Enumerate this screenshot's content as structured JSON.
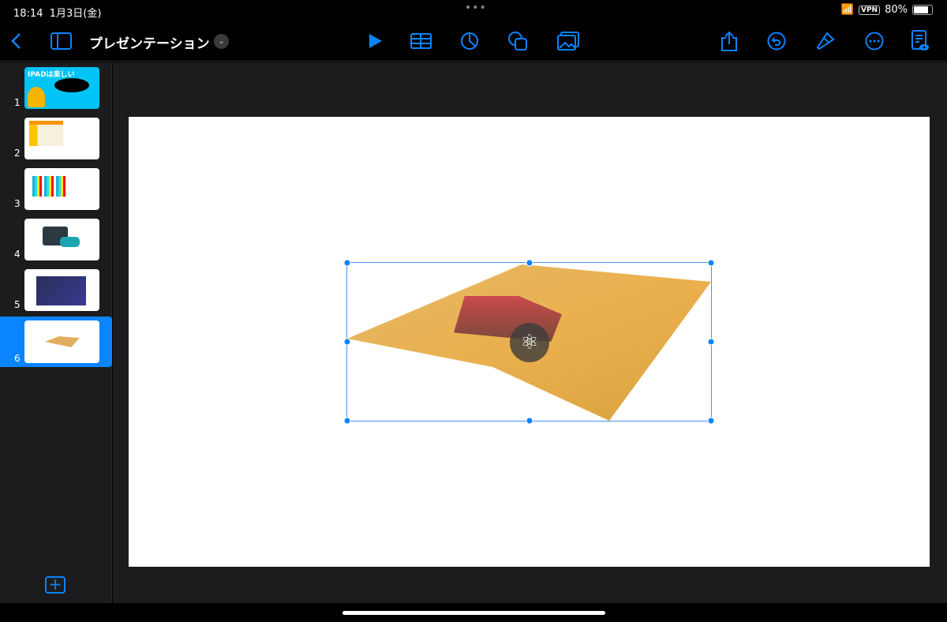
{
  "status": {
    "time": "18:14",
    "date": "1月3日(金)",
    "vpn": "VPN",
    "battery": "80%",
    "battery_level": 0.8
  },
  "toolbar": {
    "title": "プレゼンテーション"
  },
  "slides": [
    {
      "number": "1",
      "title": "IPADは楽しい"
    },
    {
      "number": "2"
    },
    {
      "number": "3"
    },
    {
      "number": "4"
    },
    {
      "number": "5"
    },
    {
      "number": "6",
      "selected": true
    }
  ],
  "colors": {
    "accent": "#0a84ff"
  }
}
